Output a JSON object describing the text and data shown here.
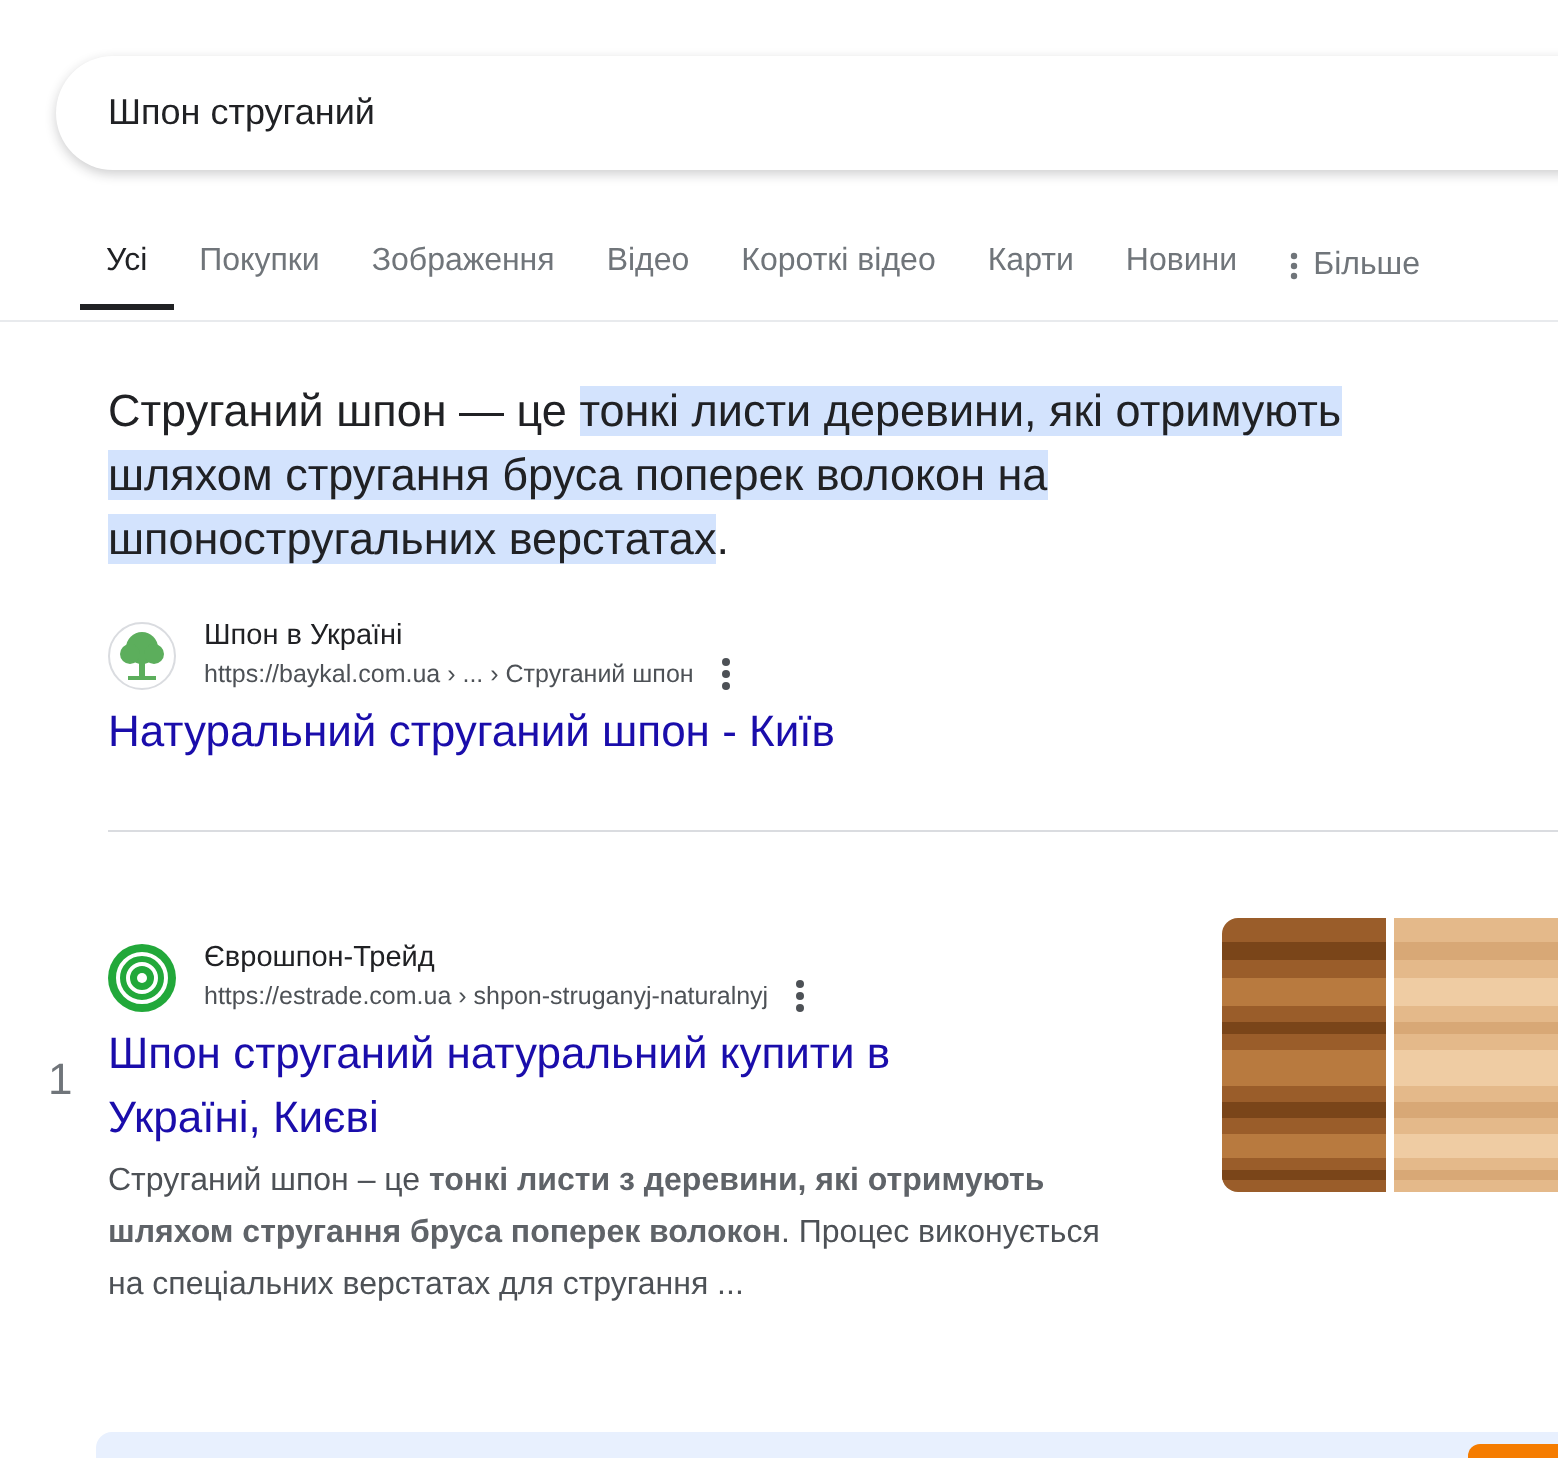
{
  "search": {
    "value": "Шпон струганий"
  },
  "tabs": [
    {
      "label": "Усі",
      "selected": true
    },
    {
      "label": "Покупки",
      "selected": false
    },
    {
      "label": "Зображення",
      "selected": false
    },
    {
      "label": "Відео",
      "selected": false
    },
    {
      "label": "Короткі відео",
      "selected": false
    },
    {
      "label": "Карти",
      "selected": false
    },
    {
      "label": "Новини",
      "selected": false
    }
  ],
  "more_tab": {
    "label": "Більше"
  },
  "featured_snippet": {
    "segments": [
      {
        "text": "Струганий шпон — це ",
        "highlighted": false
      },
      {
        "text": "тонкі листи деревини, які отримують шляхом стругання бруса поперек волокон на шпоностругальних верстатах",
        "highlighted": true
      },
      {
        "text": ".",
        "highlighted": false
      }
    ],
    "source": {
      "site_name": "Шпон в Україні",
      "url": "https://baykal.com.ua › ... › Струганий шпон",
      "title": "Натуральний струганий шпон - Київ"
    }
  },
  "results": [
    {
      "rank": "1",
      "site_name": "Єврошпон-Трейд",
      "url": "https://estrade.com.ua › shpon-struganyj-naturalnyj",
      "title": "Шпон струганий натуральний купити в Україні, Києві",
      "snippet": "Струганий шпон – це **тонкі листи з деревини, які отримують шляхом стругання бруса поперек волокон**. Процес виконується на спеціальних верстатах для стругання ..."
    }
  ]
}
